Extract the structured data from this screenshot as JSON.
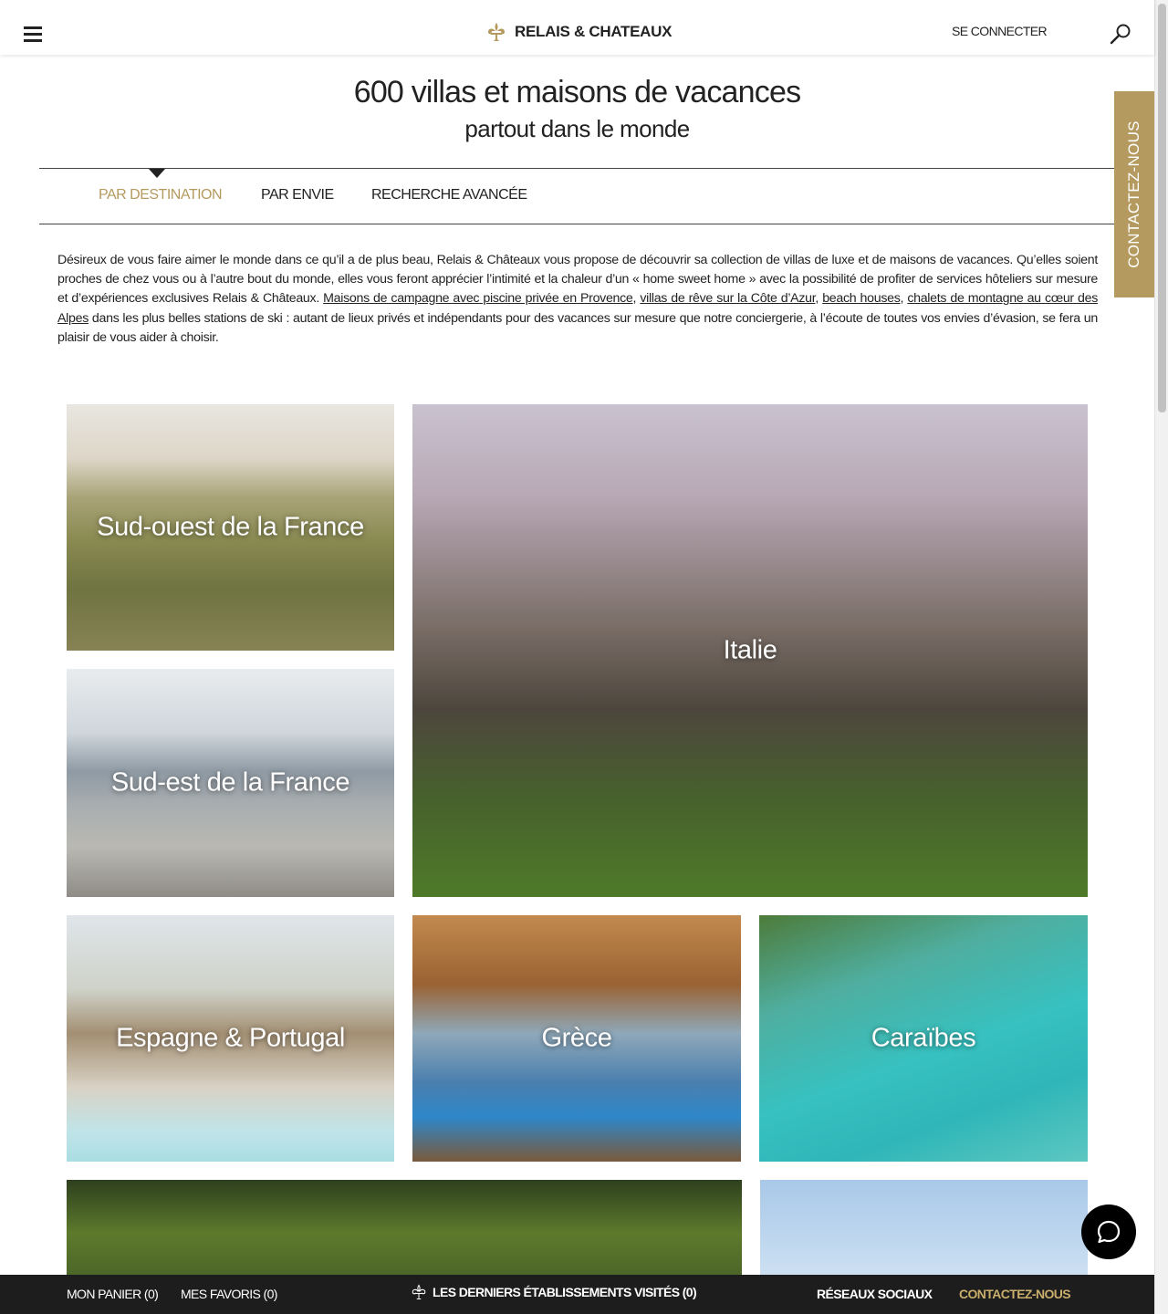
{
  "header": {
    "logo_text": "RELAIS & CHATEAUX",
    "signin_label": "SE CONNECTER"
  },
  "side_tab": {
    "label": "CONTACTEZ-NOUS"
  },
  "title": {
    "line1": "600 villas et maisons de vacances",
    "line2": "partout dans le monde"
  },
  "tabs": [
    {
      "label": "PAR DESTINATION",
      "active": true
    },
    {
      "label": "PAR ENVIE",
      "active": false
    },
    {
      "label": "RECHERCHE AVANCÉE",
      "active": false
    }
  ],
  "intro": {
    "text1": "Désireux de vous faire aimer le monde dans ce qu’il a de plus beau, Relais & Châteaux vous propose de découvrir sa collection de villas de luxe et de maisons de vacances. Qu’elles soient proches de chez vous ou à l’autre bout du monde, elles vous feront apprécier l’intimité et la chaleur d’un « home sweet home » avec la possibilité de profiter de services hôteliers sur mesure et d’expériences exclusives Relais & Châteaux. ",
    "link1": "Maisons de campagne avec piscine privée en Provence",
    "sep1": ", ",
    "link2": "villas de rêve sur la Côte d’Azur",
    "sep2": ", ",
    "link3": "beach houses",
    "sep3": ", ",
    "link4": "chalets de montagne au cœur des Alpes",
    "text2": " dans les plus belles stations de ski : autant de lieux privés et indépendants pour des vacances sur mesure que notre conciergerie, à l’écoute de toutes vos envies d’évasion, se fera un plaisir de vous aider à choisir."
  },
  "destinations": {
    "sud_ouest": "Sud-ouest de la France",
    "sud_est": "Sud-est de la France",
    "italie": "Italie",
    "espagne": "Espagne & Portugal",
    "grece": "Grèce",
    "caraibes": "Caraïbes"
  },
  "bottom_bar": {
    "cart": "MON PANIER (0)",
    "favorites": "MES FAVORIS (0)",
    "recent": "LES DERNIERS ÉTABLISSEMENTS VISITÉS (0)",
    "social": "RÉSEAUX SOCIAUX",
    "contact": "CONTACTEZ-NOUS"
  },
  "colors": {
    "accent_gold": "#b49a5f",
    "bottom_bar_bg": "#1d1d1d",
    "text": "#222222"
  },
  "icons": {
    "menu": "hamburger-icon",
    "logo": "fleur-de-lis-icon",
    "search": "search-icon",
    "chat": "chat-bubble-icon"
  }
}
